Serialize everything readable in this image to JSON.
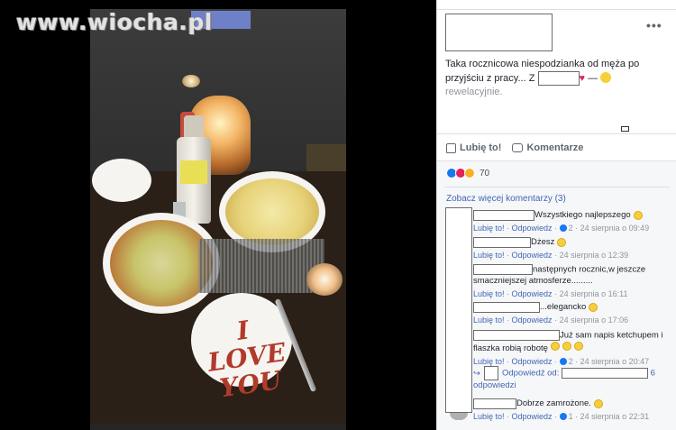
{
  "watermark": "www.wiocha.pl",
  "photo": {
    "love_line1": "I",
    "love_line2": "LOVE",
    "love_line3": "YOU"
  },
  "post": {
    "text_main": "Taka rocznicowa niespodzianka od męża po przyjściu z pracy... Z",
    "text_end": "rewelacyjnie.",
    "heart": "♥"
  },
  "actions": {
    "like": "Lubię to!",
    "comment": "Komentarze"
  },
  "reactions": {
    "count": "70"
  },
  "comments": {
    "more_label": "Zobacz więcej komentarzy (3)",
    "list": [
      {
        "text": "Wszystkiego najlepszego",
        "like": "Lubię to!",
        "reply": "Odpowiedz",
        "likes": "2",
        "time": "24 sierpnia o 09:49"
      },
      {
        "text": "Dżesz",
        "like": "Lubię to!",
        "reply": "Odpowiedz",
        "time": "24 sierpnia o 12:39"
      },
      {
        "text": "następnych rocznic,w jeszcze smaczniejszej atmosferze.........",
        "like": "Lubię to!",
        "reply": "Odpowiedz",
        "time": "24 sierpnia o 16:11"
      },
      {
        "text": "...elegancko",
        "like": "Lubię to!",
        "reply": "Odpowiedz",
        "time": "24 sierpnia o 17:06"
      },
      {
        "text": "Już sam napis ketchupem i flaszka robią robotę",
        "like": "Lubię to!",
        "reply": "Odpowiedz",
        "likes": "2",
        "time": "24 sierpnia o 20:47"
      },
      {
        "text": "Dobrze zamrożone.",
        "like": "Lubię to!",
        "reply": "Odpowiedz",
        "likes": "1",
        "time": "24 sierpnia o 22:31"
      }
    ],
    "reply_thread": {
      "label": "Odpowiedź od:",
      "count": "6",
      "suffix": "odpowiedzi"
    }
  }
}
